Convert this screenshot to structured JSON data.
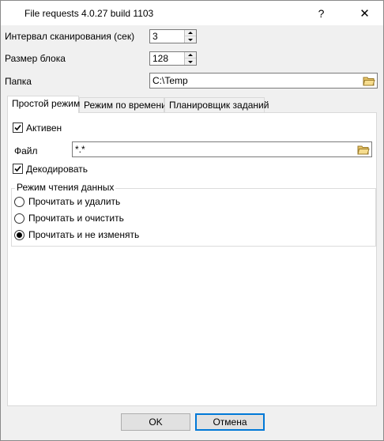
{
  "window": {
    "title": "File requests 4.0.27 build 1103",
    "help_label": "?",
    "close_label": "✕"
  },
  "settings": {
    "scan_interval_label": "Интервал сканирования (сек)",
    "scan_interval_value": "3",
    "block_size_label": "Размер блока",
    "block_size_value": "128",
    "folder_label": "Папка",
    "folder_value": "C:\\Temp"
  },
  "tabs": [
    {
      "label": "Простой режим",
      "active": true
    },
    {
      "label": "Режим по времени",
      "active": false
    },
    {
      "label": "Планировщик заданий",
      "active": false
    }
  ],
  "simple_mode": {
    "active_label": "Активен",
    "active_checked": true,
    "file_label": "Файл",
    "file_value": "*.*",
    "decode_label": "Декодировать",
    "decode_checked": true,
    "read_mode": {
      "legend": "Режим чтения данных",
      "options": [
        {
          "label": "Прочитать и удалить",
          "selected": false
        },
        {
          "label": "Прочитать и очистить",
          "selected": false
        },
        {
          "label": "Прочитать и не изменять",
          "selected": true
        }
      ]
    }
  },
  "buttons": {
    "ok_label": "OK",
    "cancel_label": "Отмена"
  },
  "colors": {
    "dialog_bg": "#f0f0f0",
    "focus_border": "#0078d7",
    "folder_icon": "#e8c468"
  }
}
